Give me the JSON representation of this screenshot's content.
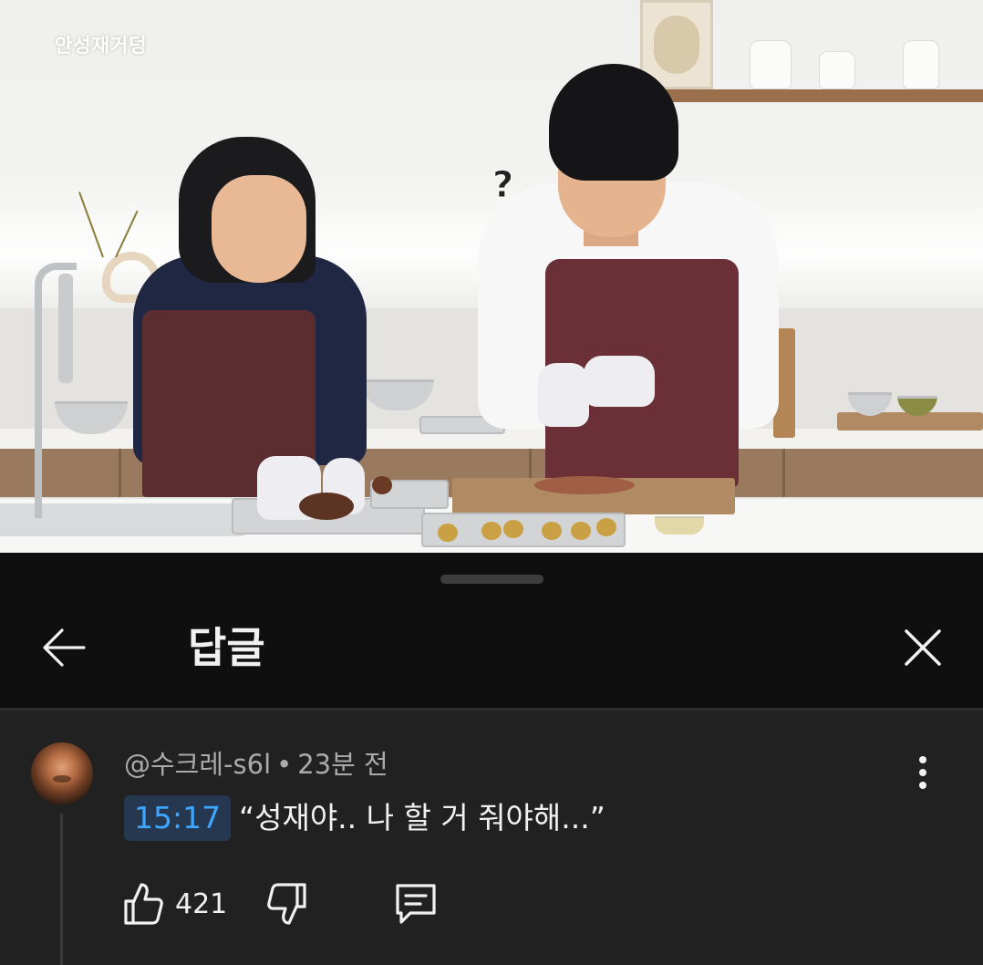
{
  "video": {
    "channel_logo": "안성재거덩",
    "caption_mark": "?"
  },
  "sheet": {
    "title": "답글",
    "back_icon": "arrow-left-icon",
    "close_icon": "close-icon"
  },
  "reply": {
    "author": "@수크레-s6l",
    "separator": "•",
    "time": "23분 전",
    "timestamp": "15:17",
    "text": "“성재야.. 나 할 거 줘야해...”",
    "like_count": "421",
    "icons": [
      "thumbs-up-icon",
      "thumbs-down-icon",
      "reply-icon",
      "more-vert-icon"
    ]
  },
  "colors": {
    "background": "#0f0f0f",
    "comment_bg": "#212121",
    "timestamp_link": "#3ea6ff",
    "timestamp_bg": "#263850",
    "meta_text": "#aaaaaa",
    "primary_text": "#f1f1f1"
  }
}
